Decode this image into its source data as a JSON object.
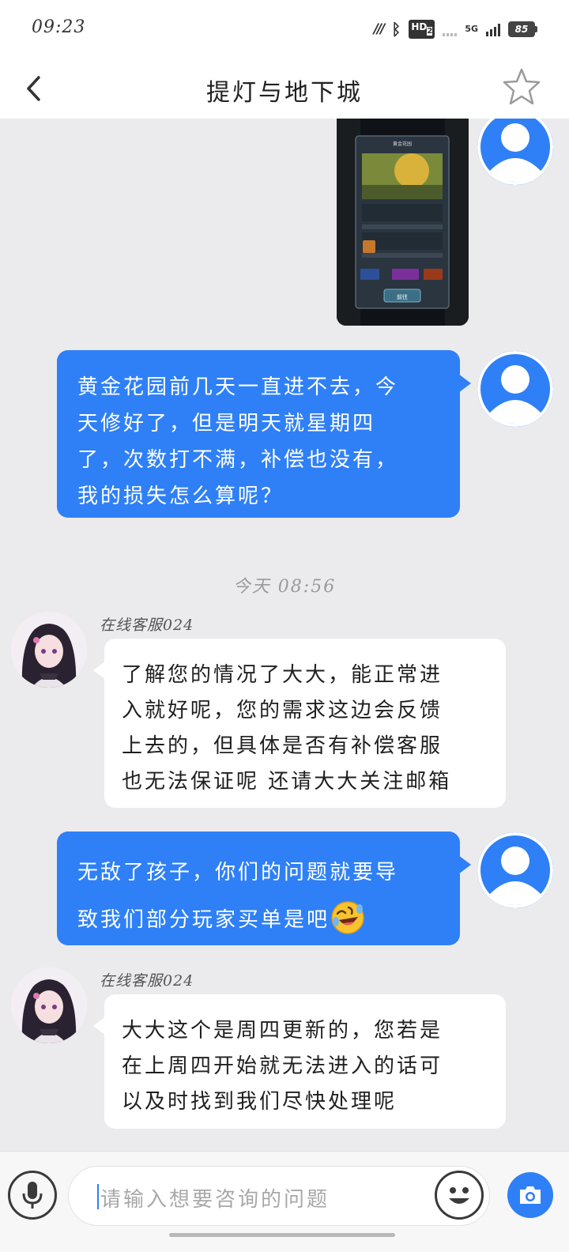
{
  "status_bar": {
    "time": "09:23",
    "network_label": "5G",
    "hd_label": "HD",
    "hd_sub": "2",
    "battery_level": "85"
  },
  "header": {
    "title": "提灯与地下城",
    "back_icon": "chevron-left-icon",
    "star_icon": "star-outline-icon"
  },
  "messages": [
    {
      "type": "image",
      "side": "right",
      "screenshot": {
        "title": "黄金花园",
        "button": "前往"
      }
    },
    {
      "type": "text",
      "side": "right",
      "text": "黄金花园前几天一直进不去，今\n天修好了，但是明天就星期四\n了，次数打不满，补偿也没有，\n我的损失怎么算呢？"
    },
    {
      "type": "timestamp",
      "text": "今天 08:56"
    },
    {
      "type": "text",
      "side": "left",
      "sender": "在线客服024",
      "text": "了解您的情况了大大，能正常进\n入就好呢，您的需求这边会反馈\n上去的，但具体是否有补偿客服\n也无法保证呢 还请大大关注邮箱"
    },
    {
      "type": "text",
      "side": "right",
      "text_line1": "无敌了孩子，你们的问题就要导",
      "text_line2": "致我们部分玩家买单是吧",
      "emoji": "rolling-on-floor-laughing"
    },
    {
      "type": "text",
      "side": "left",
      "sender": "在线客服024",
      "text": "大大这个是周四更新的，您若是\n在上周四开始就无法进入的话可\n以及时找到我们尽快处理呢"
    }
  ],
  "input_bar": {
    "placeholder": "请输入想要咨询的问题",
    "mic_icon": "microphone-icon",
    "emoji_icon": "smiley-icon",
    "camera_icon": "camera-icon"
  },
  "colors": {
    "accent": "#2f80f6",
    "background": "#ebebed",
    "bubble_in": "#ffffff"
  }
}
